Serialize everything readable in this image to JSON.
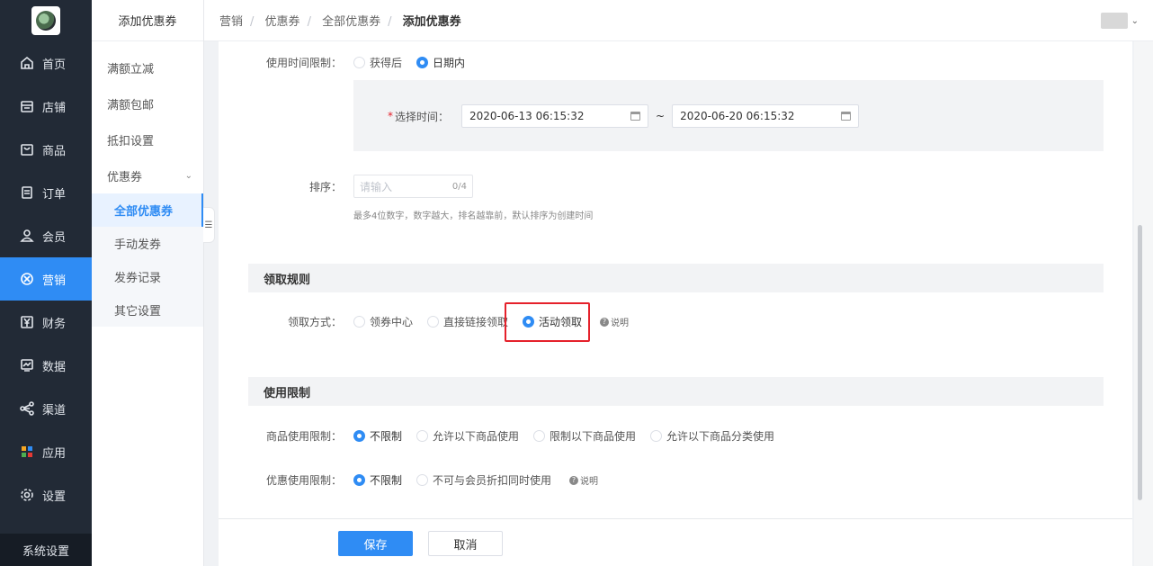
{
  "nav": {
    "items": [
      {
        "label": "首页",
        "icon": "home-icon"
      },
      {
        "label": "店铺",
        "icon": "store-icon"
      },
      {
        "label": "商品",
        "icon": "bag-icon"
      },
      {
        "label": "订单",
        "icon": "order-icon"
      },
      {
        "label": "会员",
        "icon": "user-icon"
      },
      {
        "label": "营销",
        "icon": "marketing-icon"
      },
      {
        "label": "财务",
        "icon": "yen-icon"
      },
      {
        "label": "数据",
        "icon": "chart-icon"
      },
      {
        "label": "渠道",
        "icon": "share-icon"
      },
      {
        "label": "应用",
        "icon": "apps-icon"
      },
      {
        "label": "设置",
        "icon": "gear-icon"
      }
    ],
    "system_label": "系统设置",
    "active_color": "#2f8cf4"
  },
  "subnav": {
    "title": "添加优惠券",
    "items": [
      "满额立减",
      "满额包邮",
      "抵扣设置"
    ],
    "group_label": "优惠券",
    "children": [
      "全部优惠券",
      "手动发券",
      "发券记录",
      "其它设置"
    ],
    "collapse_icon": "☰"
  },
  "breadcrumb": [
    "营销",
    "优惠券",
    "全部优惠券",
    "添加优惠券"
  ],
  "form": {
    "time_limit": {
      "label": "使用时间限制：",
      "options": [
        "获得后",
        "日期内"
      ]
    },
    "select_time": {
      "label": "选择时间：",
      "required_mark": "*",
      "start": "2020-06-13 06:15:32",
      "separator": "~",
      "end": "2020-06-20 06:15:32"
    },
    "sort": {
      "label": "排序：",
      "placeholder": "请输入",
      "count": "0/4",
      "hint": "最多4位数字，数字越大，排名越靠前，默认排序为创建时间"
    },
    "claim_section": "领取规则",
    "claim": {
      "label": "领取方式：",
      "options": [
        "领券中心",
        "直接链接领取",
        "活动领取"
      ],
      "help": "说明"
    },
    "usage_section": "使用限制",
    "product_limit": {
      "label": "商品使用限制：",
      "options": [
        "不限制",
        "允许以下商品使用",
        "限制以下商品使用",
        "允许以下商品分类使用"
      ]
    },
    "discount_limit": {
      "label": "优惠使用限制：",
      "options": [
        "不限制",
        "不可与会员折扣同时使用"
      ],
      "help": "说明"
    }
  },
  "footer": {
    "save": "保存",
    "cancel": "取消"
  }
}
